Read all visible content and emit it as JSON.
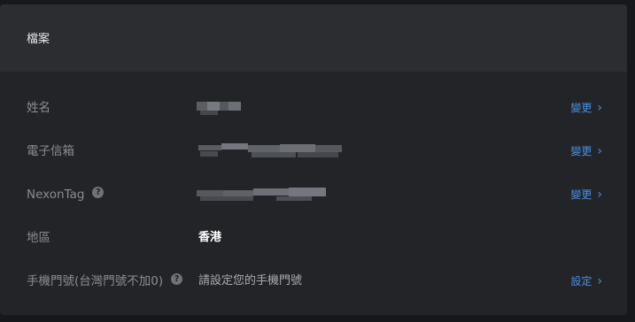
{
  "panel": {
    "title": "檔案"
  },
  "rows": [
    {
      "label": "姓名",
      "action": "變更"
    },
    {
      "label": "電子信箱",
      "action": "變更"
    },
    {
      "label": "NexonTag",
      "action": "變更"
    },
    {
      "label": "地區",
      "value": "香港"
    },
    {
      "label": "手機門號(台灣門號不加0)",
      "value": "請設定您的手機門號",
      "action": "設定"
    }
  ],
  "icons": {
    "help": "question-circle-icon",
    "chevron": "chevron-right-icon"
  },
  "help_glyph": "?",
  "chevron_glyph": "›",
  "colors": {
    "link": "#4a8fe8",
    "panel": "#232428",
    "header": "#2c2d31"
  }
}
